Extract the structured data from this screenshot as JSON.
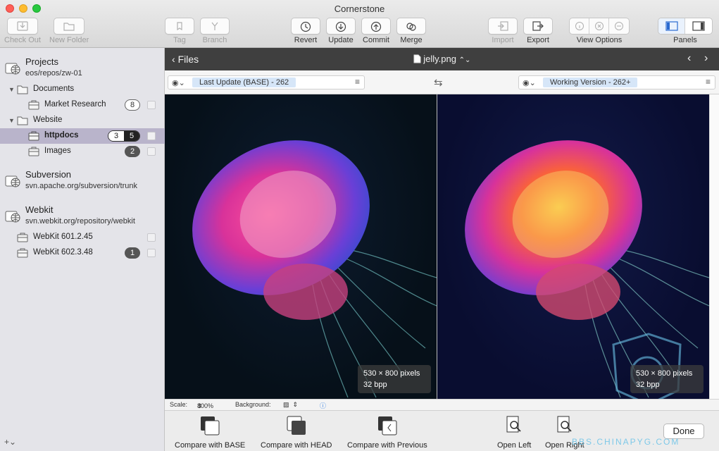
{
  "window": {
    "title": "Cornerstone"
  },
  "toolbar": {
    "check_out": "Check Out",
    "new_folder": "New Folder",
    "tag": "Tag",
    "branch": "Branch",
    "revert": "Revert",
    "update": "Update",
    "commit": "Commit",
    "merge": "Merge",
    "import": "Import",
    "export": "Export",
    "view_options": "View Options",
    "panels": "Panels"
  },
  "sidebar": {
    "projects": [
      {
        "name": "Projects",
        "path": "eos/repos/zw-01",
        "items": [
          {
            "label": "Documents",
            "type": "folder"
          },
          {
            "label": "Market Research",
            "type": "working-copy",
            "badge": "8"
          },
          {
            "label": "Website",
            "type": "folder"
          },
          {
            "label": "httpdocs",
            "type": "working-copy",
            "badge_a": "3",
            "badge_b": "5",
            "selected": true
          },
          {
            "label": "Images",
            "type": "working-copy",
            "badge": "2"
          }
        ]
      },
      {
        "name": "Subversion",
        "path": "svn.apache.org/subversion/trunk",
        "items": []
      },
      {
        "name": "Webkit",
        "path": "svn.webkit.org/repository/webkit",
        "items": [
          {
            "label": "WebKit 601.2.45",
            "type": "working-copy"
          },
          {
            "label": "WebKit 602.3.48",
            "type": "working-copy",
            "badge": "1"
          }
        ]
      }
    ],
    "add_button": "+⌄"
  },
  "pathbar": {
    "back_label": "Files",
    "filename": "jelly.png"
  },
  "compare": {
    "left_version": "Last Update (BASE) - 262",
    "right_version": "Working Version - 262+",
    "left_info": {
      "size": "530 × 800 pixels",
      "depth": "32 bpp"
    },
    "right_info": {
      "size": "530 × 800 pixels",
      "depth": "32 bpp"
    }
  },
  "status": {
    "scale_label": "Scale:",
    "scale_value": "800%",
    "background_label": "Background:"
  },
  "bottom_actions": {
    "compare_base": "Compare with BASE",
    "compare_head": "Compare with HEAD",
    "compare_previous": "Compare with Previous",
    "open_left": "Open Left",
    "open_right": "Open Right",
    "done": "Done"
  },
  "watermark": "BBS.CHINAPYG.COM",
  "colors": {
    "selection": "#b9b4cb",
    "sidebar_bg": "#e4e4e9",
    "pathbar_bg": "#3f3f3f",
    "version_tag": "#d6e6f8"
  }
}
